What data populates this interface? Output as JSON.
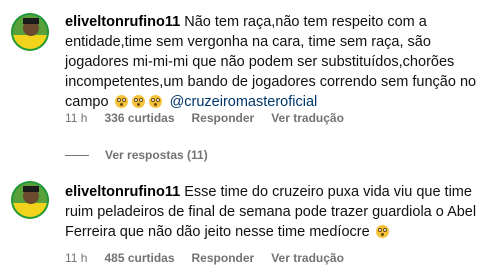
{
  "comments": [
    {
      "username": "eliveltonrufino11",
      "text": "Não tem raça,não tem respeito com a entidade,time sem vergonha na cara, time sem raça, são jogadores mi-mi-mi que não podem ser substituídos,chorões incompetentes,um bando de jogadores correndo sem função no campo",
      "emojis": [
        "flushed-face-emoji",
        "flushed-face-emoji",
        "flushed-face-emoji"
      ],
      "mention": "@cruzeiromasteroficial",
      "time": "11 h",
      "likes": "336 curtidas",
      "reply_label": "Responder",
      "translate_label": "Ver tradução"
    },
    {
      "username": "eliveltonrufino11",
      "text": "Esse time do cruzeiro puxa vida viu que time ruim peladeiros de final de semana pode trazer guardiola o Abel Ferreira que não dão jeito nesse time medíocre",
      "emojis": [
        "flushed-face-emoji"
      ],
      "time": "11 h",
      "likes": "485 curtidas",
      "reply_label": "Responder",
      "translate_label": "Ver tradução"
    }
  ],
  "view_replies_label": "Ver respostas (11)",
  "colors": {
    "text": "#000000",
    "secondary": "#737373",
    "mention": "#00376b",
    "avatar_ring": "#1f9a3c",
    "jersey": "#f2d31c"
  }
}
